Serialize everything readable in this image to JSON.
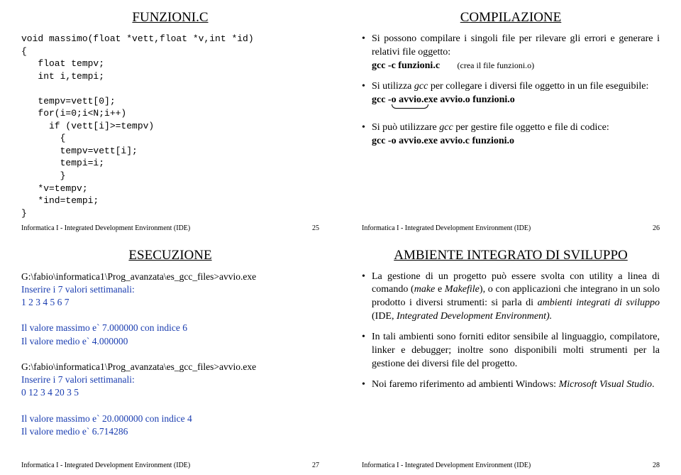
{
  "footer_label": "Informatica I  -  Integrated Development Environment (IDE)",
  "slide25": {
    "title": "FUNZIONI.C",
    "code": "void massimo(float *vett,float *v,int *id)\n{\n   float tempv;\n   int i,tempi;\n\n   tempv=vett[0];\n   for(i=0;i<N;i++)\n     if (vett[i]>=tempv)\n       {\n       tempv=vett[i];\n       tempi=i;\n       }\n   *v=tempv;\n   *ind=tempi;\n}",
    "page": "25"
  },
  "slide26": {
    "title": "COMPILAZIONE",
    "b1": "Si possono compilare i singoli file per rilevare gli errori e generare i relativi file oggetto:",
    "b1cmd": "gcc  -c  funzioni.c",
    "b1note": "(crea il file funzioni.o)",
    "b2a": "Si utilizza  ",
    "b2b": " per collegare i diversi file oggetto in un file eseguibile:",
    "b2cmd": "gcc   -o  avvio.exe   avvio.o   funzioni.o",
    "b3a": "Si può utilizzare ",
    "b3b": " per gestire file oggetto e file di codice:",
    "b3cmd": "gcc  -o  avvio.exe   avvio.c   funzioni.o",
    "gcc": "gcc",
    "page": "26"
  },
  "slide27": {
    "title": "ESECUZIONE",
    "line1": "G:\\fabio\\informatica1\\Prog_avanzata\\es_gcc_files>avvio.exe",
    "line2": "Inserire i 7 valori settimanali:",
    "line3": "1 2 3 4 5 6 7",
    "line4": " Il valore massimo e` 7.000000 con indice 6",
    "line5": " Il valore medio e` 4.000000",
    "line6": "G:\\fabio\\informatica1\\Prog_avanzata\\es_gcc_files>avvio.exe",
    "line7": "Inserire i 7 valori settimanali:",
    "line8": "0 12 3 4 20 3 5",
    "line9": " Il valore massimo e` 20.000000 con indice 4",
    "line10": " Il valore medio e` 6.714286",
    "page": "27"
  },
  "slide28": {
    "title": "AMBIENTE INTEGRATO DI SVILUPPO",
    "b1a": "La gestione di un progetto  può essere svolta con utility a linea di comando (",
    "b1i1": "make",
    "b1m": " e ",
    "b1i2": "Makefile",
    "b1b": "), o con applicazioni che integrano in un solo prodotto i diversi strumenti: si parla di ",
    "b1i3": "ambienti integrati di sviluppo",
    "b1c": " (IDE, ",
    "b1i4": "Integrated Development Environment).",
    "b2": "In tali ambienti sono forniti editor sensibile al linguaggio, compilatore, linker e debugger; inoltre sono disponibili molti strumenti per la gestione dei diversi file del progetto.",
    "b3a": "Noi faremo riferimento ad ambienti Windows: ",
    "b3i": "Microsoft Visual Studio",
    "b3b": ".",
    "page": "28"
  }
}
